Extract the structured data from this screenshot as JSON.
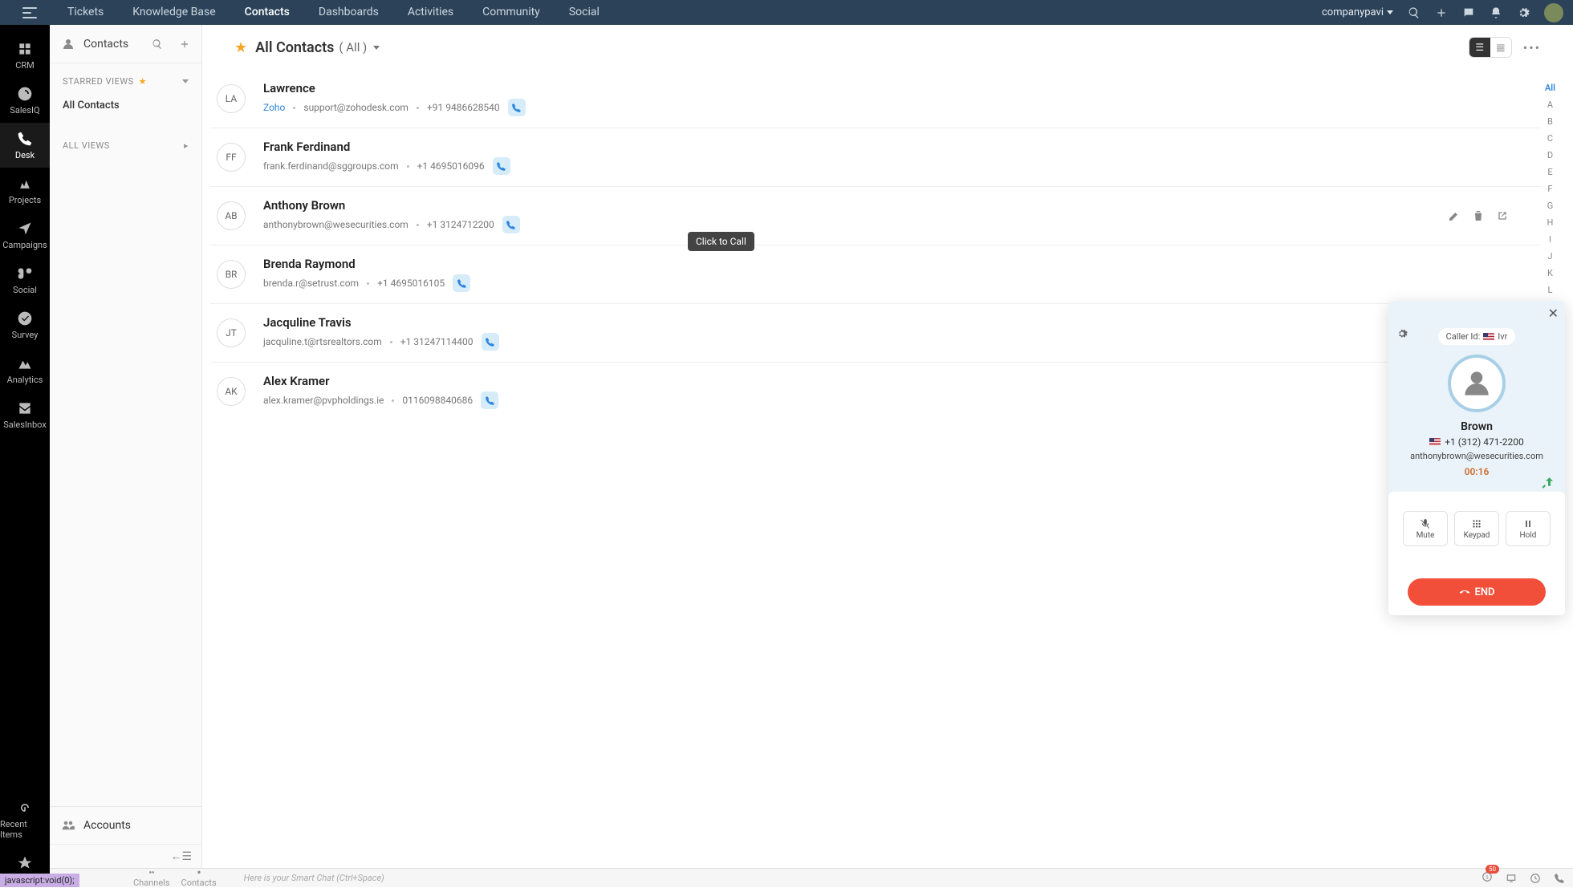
{
  "topnav": {
    "items": [
      "Tickets",
      "Knowledge Base",
      "Contacts",
      "Dashboards",
      "Activities",
      "Community",
      "Social"
    ],
    "active_index": 2,
    "company": "companypavi"
  },
  "left_rail": {
    "items": [
      {
        "label": "CRM"
      },
      {
        "label": "SalesIQ"
      },
      {
        "label": "Desk"
      },
      {
        "label": "Projects"
      },
      {
        "label": "Campaigns"
      },
      {
        "label": "Social"
      },
      {
        "label": "Survey"
      },
      {
        "label": "Analytics"
      },
      {
        "label": "SalesInbox"
      }
    ],
    "active_index": 2,
    "bottom_items": [
      {
        "label": "Recent Items"
      },
      {
        "label": ""
      }
    ]
  },
  "side_panel": {
    "title": "Contacts",
    "starred_label": "STARRED VIEWS",
    "all_views_label": "ALL VIEWS",
    "links": [
      {
        "label": "All Contacts",
        "active": true
      }
    ],
    "accounts_label": "Accounts"
  },
  "main": {
    "title": "All Contacts",
    "count_label": "( All )"
  },
  "contacts": [
    {
      "initials": "LA",
      "name": "Lawrence",
      "company": "Zoho",
      "email": "support@zohodesk.com",
      "phone": "+91 9486628540"
    },
    {
      "initials": "FF",
      "name": "Frank Ferdinand",
      "company": "",
      "email": "frank.ferdinand@sggroups.com",
      "phone": "+1 4695016096"
    },
    {
      "initials": "AB",
      "name": "Anthony Brown",
      "company": "",
      "email": "anthonybrown@wesecurities.com",
      "phone": "+1 3124712200",
      "hover": true
    },
    {
      "initials": "BR",
      "name": "Brenda Raymond",
      "company": "",
      "email": "brenda.r@setrust.com",
      "phone": "+1 4695016105"
    },
    {
      "initials": "JT",
      "name": "Jacquline Travis",
      "company": "",
      "email": "jacquline.t@rtsrealtors.com",
      "phone": "+1 31247114400"
    },
    {
      "initials": "AK",
      "name": "Alex Kramer",
      "company": "",
      "email": "alex.kramer@pvpholdings.ie",
      "phone": "0116098840686"
    }
  ],
  "tooltip": {
    "click_to_call": "Click to Call"
  },
  "alpha_index": [
    "All",
    "A",
    "B",
    "C",
    "D",
    "E",
    "F",
    "G",
    "H",
    "I",
    "J",
    "K",
    "L"
  ],
  "call_panel": {
    "caller_id_label": "Caller Id:",
    "caller_id_value": "Ivr",
    "name": "Brown",
    "phone": "+1 (312) 471-2200",
    "email": "anthonybrown@wesecurities.com",
    "timer": "00:16",
    "mute": "Mute",
    "keypad": "Keypad",
    "hold": "Hold",
    "end": "END"
  },
  "bottom": {
    "channels": "Channels",
    "contacts": "Contacts",
    "smart_chat": "Here is your Smart Chat (Ctrl+Space)",
    "badge": "50",
    "jsvoid": "javascript:void(0);"
  }
}
